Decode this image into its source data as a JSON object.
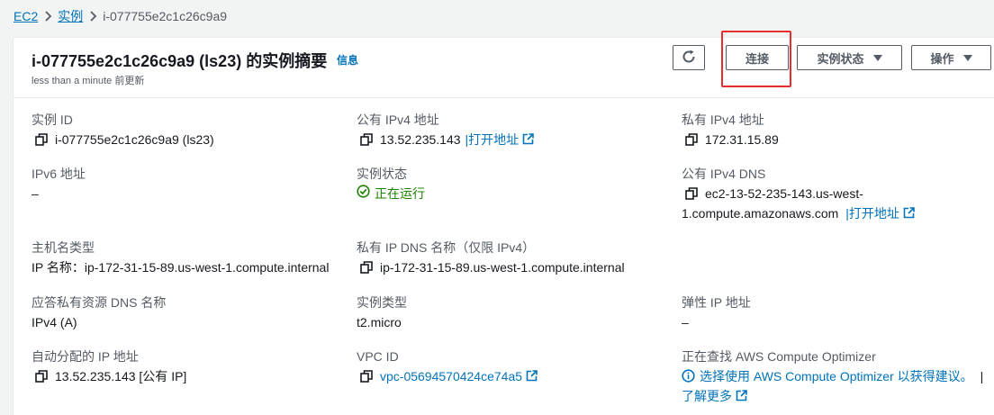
{
  "breadcrumb": {
    "ec2": "EC2",
    "instances": "实例",
    "current": "i-077755e2c1c26c9a9"
  },
  "header": {
    "title": "i-077755e2c1c26c9a9 (ls23) 的实例摘要",
    "info": "信息",
    "subtitle": "less than a minute 前更新",
    "connect": "连接",
    "instance_state": "实例状态",
    "actions": "操作"
  },
  "fields": {
    "instance_id": {
      "label": "实例 ID",
      "value": "i-077755e2c1c26c9a9 (ls23)"
    },
    "public_ipv4": {
      "label": "公有 IPv4 地址",
      "value": "13.52.235.143",
      "link": "|打开地址"
    },
    "private_ipv4": {
      "label": "私有 IPv4 地址",
      "value": "172.31.15.89"
    },
    "ipv6": {
      "label": "IPv6 地址",
      "value": "–"
    },
    "state": {
      "label": "实例状态",
      "value": "正在运行"
    },
    "public_dns": {
      "label": "公有 IPv4 DNS",
      "value_line1": "ec2-13-52-235-143.us-west-",
      "value_line2": "1.compute.amazonaws.com",
      "link": "|打开地址"
    },
    "hostname_type": {
      "label": "主机名类型",
      "value": "IP 名称：ip-172-31-15-89.us-west-1.compute.internal"
    },
    "private_dns": {
      "label": "私有 IP DNS 名称（仅限 IPv4）",
      "value": "ip-172-31-15-89.us-west-1.compute.internal"
    },
    "answer_dns": {
      "label": "应答私有资源 DNS 名称",
      "value": "IPv4 (A)"
    },
    "instance_type": {
      "label": "实例类型",
      "value": "t2.micro"
    },
    "elastic_ip": {
      "label": "弹性 IP 地址",
      "value": "–"
    },
    "auto_ip": {
      "label": "自动分配的 IP 地址",
      "value": "13.52.235.143 [公有 IP]"
    },
    "vpc_id": {
      "label": "VPC ID",
      "value": "vpc-05694570424ce74a5"
    },
    "optimizer": {
      "label": "正在查找 AWS Compute Optimizer",
      "link1": "选择使用 AWS Compute Optimizer 以获得建议。",
      "sep": "|",
      "link2": "了解更多"
    }
  },
  "colors": {
    "link": "#0073bb",
    "success": "#1d8102",
    "highlight": "#e62e2e",
    "label": "#545b64"
  },
  "icons": [
    "chevron-right-icon",
    "refresh-icon",
    "caret-down-icon",
    "copy-icon",
    "external-link-icon",
    "check-circle-icon",
    "info-circle-icon"
  ]
}
